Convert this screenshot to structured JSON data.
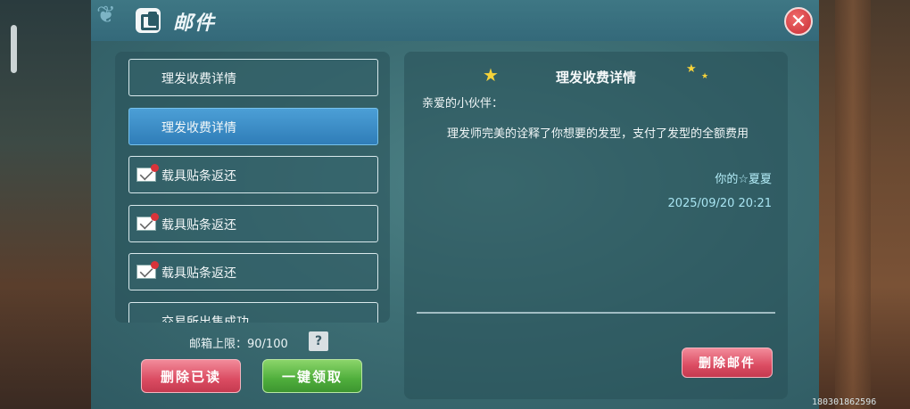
{
  "window": {
    "title": "邮件"
  },
  "mail_list": {
    "items": [
      {
        "label": "理发收费详情",
        "has_attachment": false,
        "active": false
      },
      {
        "label": "理发收费详情",
        "has_attachment": false,
        "active": true
      },
      {
        "label": "载具贴条返还",
        "has_attachment": true,
        "active": false
      },
      {
        "label": "载具贴条返还",
        "has_attachment": true,
        "active": false
      },
      {
        "label": "载具贴条返还",
        "has_attachment": true,
        "active": false
      },
      {
        "label": "交易所出售成功",
        "has_attachment": false,
        "active": false
      }
    ],
    "capacity_label": "邮箱上限：90/100",
    "help_symbol": "?"
  },
  "buttons": {
    "delete_read": "删除已读",
    "claim_all": "一键领取",
    "delete_mail": "删除邮件"
  },
  "detail": {
    "title": "理发收费详情",
    "greeting": "亲爱的小伙伴：",
    "body": "理发师完美的诠释了你想要的发型，支付了发型的全额费用",
    "sender": "你的☆夏夏",
    "date": "2025/09/20 20:21"
  },
  "footer": {
    "uid": "180301862596"
  },
  "colors": {
    "accent_blue": "#3a8cc8",
    "button_red": "#db4c62",
    "button_green": "#4fae3c",
    "date_color": "#a8e4f1"
  }
}
